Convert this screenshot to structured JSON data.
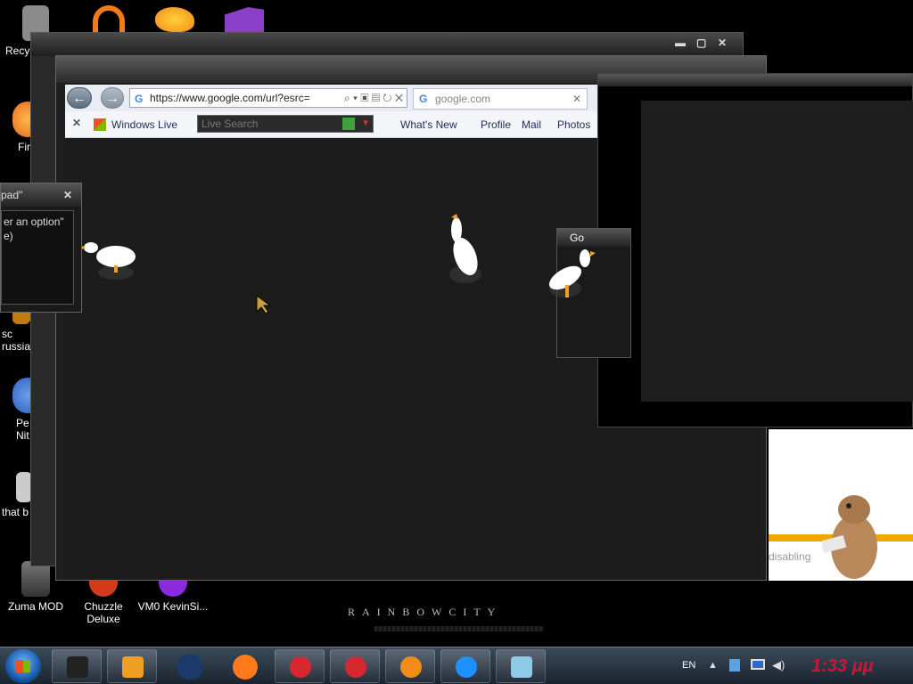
{
  "desktop": {
    "icons": [
      {
        "label": "Recy",
        "color": "#8a8a8a"
      },
      {
        "label": "Fir",
        "color": "#e96a1c"
      },
      {
        "label": "sc russia",
        "color": "#c07a10"
      },
      {
        "label": "Pe Nit",
        "color": "#2a62c9"
      },
      {
        "label": "that b",
        "color": "#cccccc"
      },
      {
        "label": "Zuma MOD",
        "color": "#555555"
      },
      {
        "label": "Chuzzle Deluxe",
        "color": "#d23a1b"
      },
      {
        "label": "VM0 KevinSi...",
        "color": "#8a2be2"
      }
    ],
    "wallpaper_text": "RAINBOWCITY"
  },
  "browser": {
    "url": "https://www.google.com/url?esrc=",
    "tab_title": "google.com",
    "favorites": {
      "windows_live": "Windows Live",
      "search_placeholder": "Live Search",
      "whats_new": "What's New",
      "profile": "Profile",
      "mail": "Mail",
      "photos": "Photos"
    }
  },
  "dialog": {
    "title": "pad\"",
    "line1": "er an option\"",
    "line2": "e)"
  },
  "mini_window": {
    "title": "Go"
  },
  "loading_panel": {
    "text": "disabling"
  },
  "taskbar": {
    "apps": [
      {
        "name": "terminal",
        "color": "#222222"
      },
      {
        "name": "media-player",
        "color": "#f0a020"
      },
      {
        "name": "globe",
        "color": "#1b3a6b"
      },
      {
        "name": "firefox",
        "color": "#ff7a1a"
      },
      {
        "name": "pinball",
        "color": "#d7282f"
      },
      {
        "name": "pinball-2",
        "color": "#d7282f"
      },
      {
        "name": "goldfish",
        "color": "#f28c18"
      },
      {
        "name": "internet-explorer",
        "color": "#1e90ff"
      },
      {
        "name": "notepad",
        "color": "#8fc9e8"
      }
    ],
    "language": "EN",
    "clock": "1:33 μμ"
  }
}
